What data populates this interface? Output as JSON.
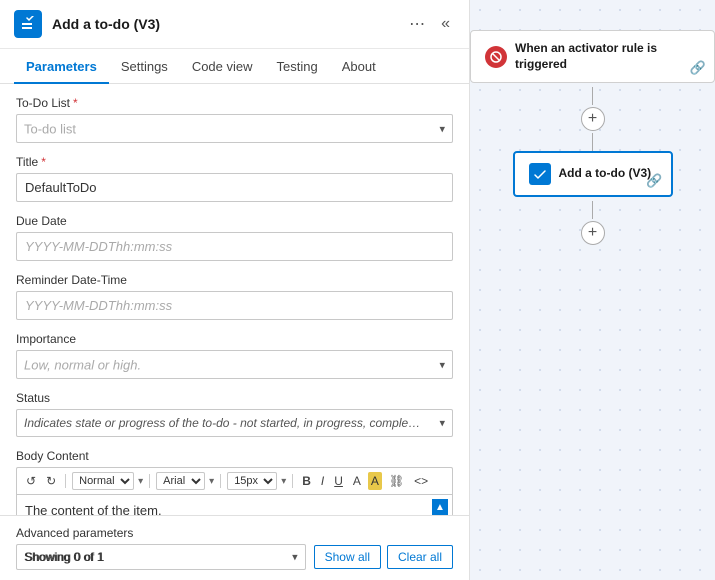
{
  "header": {
    "title": "Add a to-do (V3)",
    "icon_label": "checkbox-icon",
    "more_icon": "⋯",
    "collapse_icon": "«"
  },
  "tabs": [
    {
      "id": "parameters",
      "label": "Parameters",
      "active": true
    },
    {
      "id": "settings",
      "label": "Settings",
      "active": false
    },
    {
      "id": "codeview",
      "label": "Code view",
      "active": false
    },
    {
      "id": "testing",
      "label": "Testing",
      "active": false
    },
    {
      "id": "about",
      "label": "About",
      "active": false
    }
  ],
  "fields": {
    "todo_list": {
      "label": "To-Do List",
      "required": true,
      "placeholder": "To-do list",
      "value": ""
    },
    "title": {
      "label": "Title",
      "required": true,
      "placeholder": "",
      "value": "DefaultToDo"
    },
    "due_date": {
      "label": "Due Date",
      "placeholder": "YYYY-MM-DDThh:mm:ss",
      "value": ""
    },
    "reminder_datetime": {
      "label": "Reminder Date-Time",
      "placeholder": "YYYY-MM-DDThh:mm:ss",
      "value": ""
    },
    "importance": {
      "label": "Importance",
      "placeholder": "Low, normal or high.",
      "value": ""
    },
    "status": {
      "label": "Status",
      "placeholder": "Indicates state or progress of the to-do - not started, in progress, completed, waiting on o...",
      "value": ""
    }
  },
  "body_content": {
    "label": "Body Content",
    "toolbar": {
      "undo": "↺",
      "redo": "↻",
      "format_label": "Normal",
      "font_label": "Arial",
      "size_label": "15px",
      "bold": "B",
      "italic": "I",
      "underline": "U",
      "font_color": "A",
      "highlight": "A",
      "link": "⛓",
      "code": "<>"
    },
    "content": "The content of the item."
  },
  "advanced": {
    "label": "Advanced parameters",
    "select_value": "Showing 0 of 1",
    "show_all_btn": "Show all",
    "clear_all_btn": "Clear all"
  },
  "flow": {
    "trigger": {
      "icon": "⊘",
      "title": "When an activator rule is triggered"
    },
    "action": {
      "icon": "✓",
      "title": "Add a to-do (V3)"
    }
  }
}
